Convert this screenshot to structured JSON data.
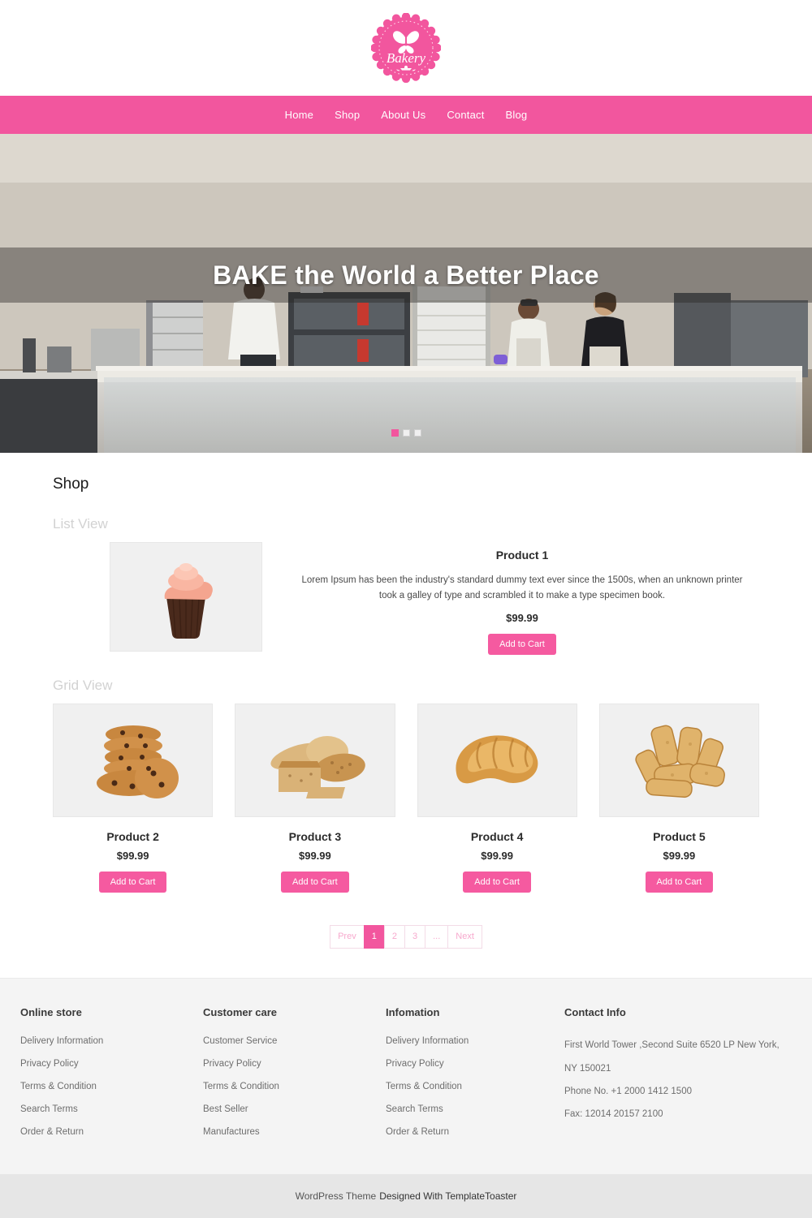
{
  "brand": {
    "logo_text": "Bakery",
    "logo_icon": "bakery-badge-icon",
    "accent_color": "#f2569e"
  },
  "nav": {
    "items": [
      {
        "label": "Home"
      },
      {
        "label": "Shop"
      },
      {
        "label": "About Us"
      },
      {
        "label": "Contact"
      },
      {
        "label": "Blog"
      }
    ]
  },
  "hero": {
    "title": "BAKE the World a Better Place",
    "image_alt": "bakery-kitchen-display-case",
    "slides": [
      {
        "active": true
      },
      {
        "active": false
      },
      {
        "active": false
      }
    ]
  },
  "shop": {
    "title": "Shop",
    "list_view_label": "List View",
    "grid_view_label": "Grid View",
    "add_to_cart_label": "Add to Cart",
    "list_product": {
      "name": "Product 1",
      "description": "Lorem Ipsum has been the industry's standard dummy text ever since the 1500s, when an unknown printer took a galley of type and scrambled it to make a type specimen book.",
      "price": "$99.99",
      "image_alt": "pink-frosted-cupcake"
    },
    "grid_products": [
      {
        "name": "Product 2",
        "price": "$99.99",
        "image_alt": "chocolate-chip-cookie-stack"
      },
      {
        "name": "Product 3",
        "price": "$99.99",
        "image_alt": "assorted-bread-loaves"
      },
      {
        "name": "Product 4",
        "price": "$99.99",
        "image_alt": "golden-croissant"
      },
      {
        "name": "Product 5",
        "price": "$99.99",
        "image_alt": "toasted-bread-rusks"
      }
    ],
    "pagination": [
      {
        "label": "Prev",
        "active": false
      },
      {
        "label": "1",
        "active": true
      },
      {
        "label": "2",
        "active": false
      },
      {
        "label": "3",
        "active": false
      },
      {
        "label": "...",
        "active": false
      },
      {
        "label": "Next",
        "active": false
      }
    ]
  },
  "footer": {
    "columns": [
      {
        "heading": "Online store",
        "links": [
          {
            "label": "Delivery Information"
          },
          {
            "label": "Privacy Policy"
          },
          {
            "label": "Terms & Condition"
          },
          {
            "label": "Search Terms"
          },
          {
            "label": "Order & Return"
          }
        ]
      },
      {
        "heading": "Customer care",
        "links": [
          {
            "label": "Customer Service"
          },
          {
            "label": "Privacy Policy"
          },
          {
            "label": "Terms & Condition"
          },
          {
            "label": "Best Seller"
          },
          {
            "label": "Manufactures"
          }
        ]
      },
      {
        "heading": "Infomation",
        "links": [
          {
            "label": "Delivery Information"
          },
          {
            "label": "Privacy Policy"
          },
          {
            "label": "Terms & Condition"
          },
          {
            "label": "Search Terms"
          },
          {
            "label": "Order & Return"
          }
        ]
      }
    ],
    "contact": {
      "heading": "Contact Info",
      "address_line1": "First World Tower ,Second Suite 6520 LP New York,",
      "address_line2": "NY 150021",
      "phone": "Phone No. +1 2000 1412 1500",
      "fax": "Fax: 12014 20157 2100"
    },
    "copyright_prefix": "WordPress Theme",
    "copyright_strong": "Designed With TemplateToaster"
  }
}
